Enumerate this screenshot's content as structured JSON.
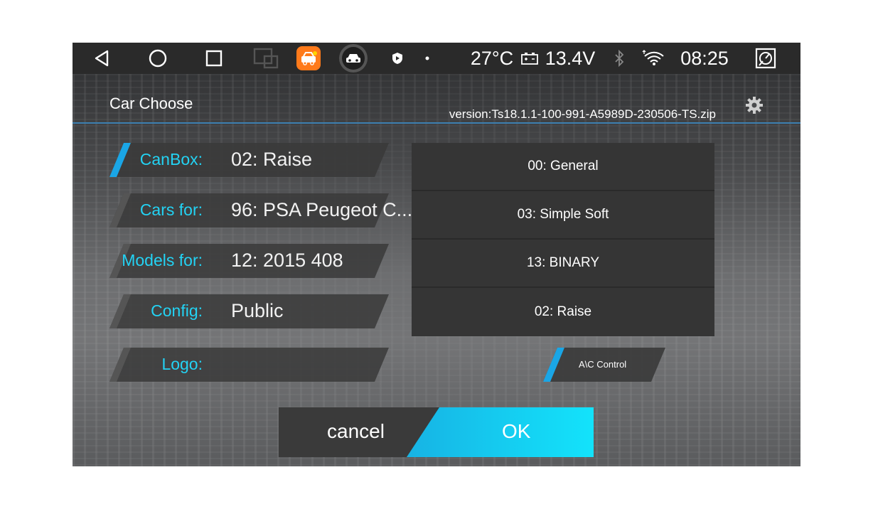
{
  "statusbar": {
    "temperature": "27°C",
    "voltage": "13.4V",
    "time": "08:25",
    "apps": [
      "car-settings-app",
      "car-app"
    ]
  },
  "header": {
    "title": "Car Choose",
    "version": "version:Ts18.1.1-100-991-A5989D-230506-TS.zip"
  },
  "fields": [
    {
      "label": "CanBox:",
      "value": "02: Raise",
      "active": true
    },
    {
      "label": "Cars for:",
      "value": "96: PSA Peugeot C...",
      "active": false
    },
    {
      "label": "Models for:",
      "value": "12: 2015 408",
      "active": false
    },
    {
      "label": "Config:",
      "value": "Public",
      "active": false
    },
    {
      "label": "Logo:",
      "value": "",
      "active": false
    }
  ],
  "list": [
    "00: General",
    "03: Simple Soft",
    "13: BINARY",
    "02: Raise"
  ],
  "ac_button": "A\\C Control",
  "buttons": {
    "cancel": "cancel",
    "ok": "OK"
  },
  "colors": {
    "accent": "#23d3f4",
    "ok_gradient_start": "#17b3e4",
    "ok_gradient_end": "#13e3fb",
    "divider": "#3c7fb0"
  }
}
